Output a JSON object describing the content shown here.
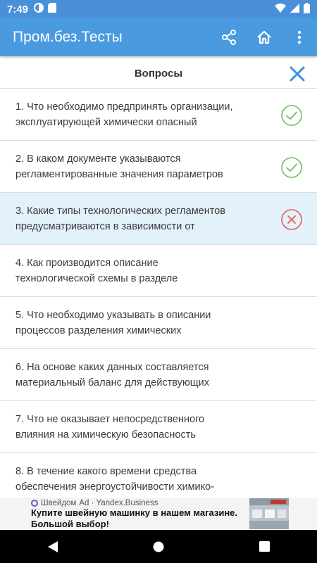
{
  "status_bar": {
    "time": "7:49"
  },
  "app_bar": {
    "title": "Пром.без.Тесты"
  },
  "dialog": {
    "title": "Вопросы"
  },
  "questions": [
    {
      "number": "1.",
      "line1": "Что необходимо предпринять организации,",
      "line2": "эксплуатирующей химически опасный",
      "status": "correct"
    },
    {
      "number": "2.",
      "line1": "В каком документе указываются",
      "line2": "регламентированные значения параметров",
      "status": "correct"
    },
    {
      "number": "3.",
      "line1": "Какие типы технологических регламентов",
      "line2": "предусматриваются в зависимости от",
      "status": "wrong"
    },
    {
      "number": "4.",
      "line1": "Как производится описание",
      "line2": "технологической схемы в разделе",
      "status": "none"
    },
    {
      "number": "5.",
      "line1": "Что необходимо указывать в описании",
      "line2": "процессов разделения химических",
      "status": "none"
    },
    {
      "number": "6.",
      "line1": "На основе каких данных составляется",
      "line2": "материальный баланс для действующих",
      "status": "none"
    },
    {
      "number": "7.",
      "line1": "Что не оказывает непосредственного",
      "line2": "влияния на химическую безопасность",
      "status": "none"
    },
    {
      "number": "8.",
      "line1": "В течение какого времени средства",
      "line2": "обеспечения энергоустойчивости химико-",
      "status": "none"
    }
  ],
  "ad": {
    "brand": "Швейдом",
    "label": "Ad · Yandex.Business",
    "headline_line1": "Купите швейную машинку в нашем магазине.",
    "headline_line2": "Большой выбор!"
  },
  "colors": {
    "app_bar": "#4a9ae0",
    "active_row": "#e3f1fb",
    "correct": "#6cbf5a",
    "wrong": "#e45b5b",
    "close": "#3d8fd8"
  }
}
